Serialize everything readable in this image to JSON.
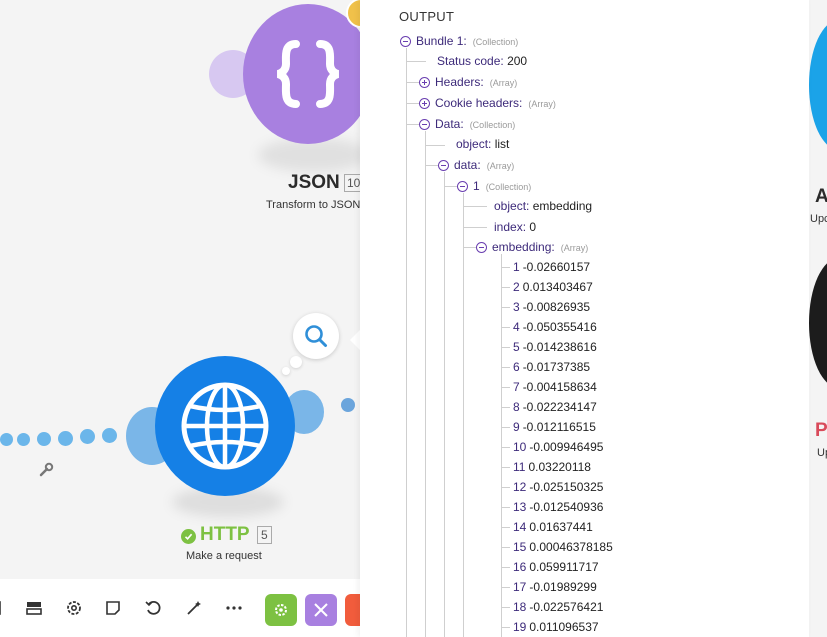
{
  "canvas": {
    "json_module": {
      "title": "JSON",
      "badge": "10",
      "subtitle": "Transform to JSON",
      "icon": "curly-braces-icon",
      "color": "#a880e0"
    },
    "http_module": {
      "title": "HTTP",
      "badge": "5",
      "subtitle": "Make a request",
      "icon": "globe-icon",
      "color": "#1580e6",
      "status": "success"
    },
    "right_modules": {
      "top_letter": "A",
      "top_sub": "Upc",
      "bottom_letter": "P",
      "bottom_sub": "Up"
    }
  },
  "toolbar": {
    "items": [
      "scenario-io-icon",
      "export-icon",
      "settings-icon",
      "notes-icon",
      "undo-icon",
      "magic-wand-icon",
      "more-icon"
    ],
    "buttons": [
      {
        "name": "gear-button",
        "color": "#7dc142"
      },
      {
        "name": "tools-button",
        "color": "#a880e0"
      },
      {
        "name": "flow-control-button",
        "color": "#f15c3c"
      }
    ]
  },
  "output": {
    "title": "OUTPUT",
    "bundle": {
      "label": "Bundle 1:",
      "type": "(Collection)"
    },
    "status_code": {
      "key": "Status code:",
      "value": "200"
    },
    "headers": {
      "key": "Headers:",
      "type": "(Array)"
    },
    "cookie_headers": {
      "key": "Cookie headers:",
      "type": "(Array)"
    },
    "data": {
      "key": "Data:",
      "type": "(Collection)"
    },
    "object_list": {
      "key": "object:",
      "value": "list"
    },
    "data_array": {
      "key": "data:",
      "type": "(Array)"
    },
    "item1": {
      "key": "1",
      "type": "(Collection)"
    },
    "object_embedding": {
      "key": "object:",
      "value": "embedding"
    },
    "index": {
      "key": "index:",
      "value": "0"
    },
    "embedding": {
      "key": "embedding:",
      "type": "(Array)"
    },
    "embedding_values": [
      {
        "i": "1",
        "v": "-0.02660157"
      },
      {
        "i": "2",
        "v": "0.013403467"
      },
      {
        "i": "3",
        "v": "-0.00826935"
      },
      {
        "i": "4",
        "v": "-0.050355416"
      },
      {
        "i": "5",
        "v": "-0.014238616"
      },
      {
        "i": "6",
        "v": "-0.01737385"
      },
      {
        "i": "7",
        "v": "-0.004158634"
      },
      {
        "i": "8",
        "v": "-0.022234147"
      },
      {
        "i": "9",
        "v": "-0.012116515"
      },
      {
        "i": "10",
        "v": "-0.009946495"
      },
      {
        "i": "11",
        "v": "0.03220118"
      },
      {
        "i": "12",
        "v": "-0.025150325"
      },
      {
        "i": "13",
        "v": "-0.012540936"
      },
      {
        "i": "14",
        "v": "0.01637441"
      },
      {
        "i": "15",
        "v": "0.00046378185"
      },
      {
        "i": "16",
        "v": "0.059911717"
      },
      {
        "i": "17",
        "v": "-0.01989299"
      },
      {
        "i": "18",
        "v": "-0.022576421"
      },
      {
        "i": "19",
        "v": "0.011096537"
      }
    ]
  }
}
